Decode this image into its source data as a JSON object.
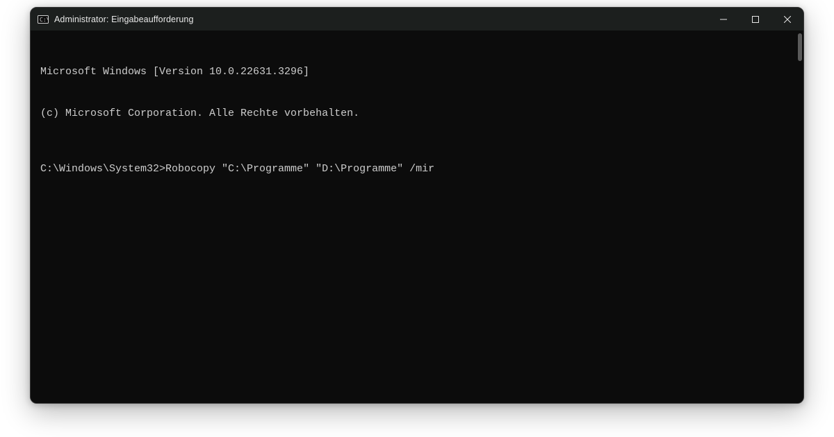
{
  "window": {
    "title": "Administrator: Eingabeaufforderung"
  },
  "terminal": {
    "line1": "Microsoft Windows [Version 10.0.22631.3296]",
    "line2": "(c) Microsoft Corporation. Alle Rechte vorbehalten.",
    "prompt": "C:\\Windows\\System32>",
    "command": "Robocopy \"C:\\Programme\" \"D:\\Programme\" /mir"
  }
}
